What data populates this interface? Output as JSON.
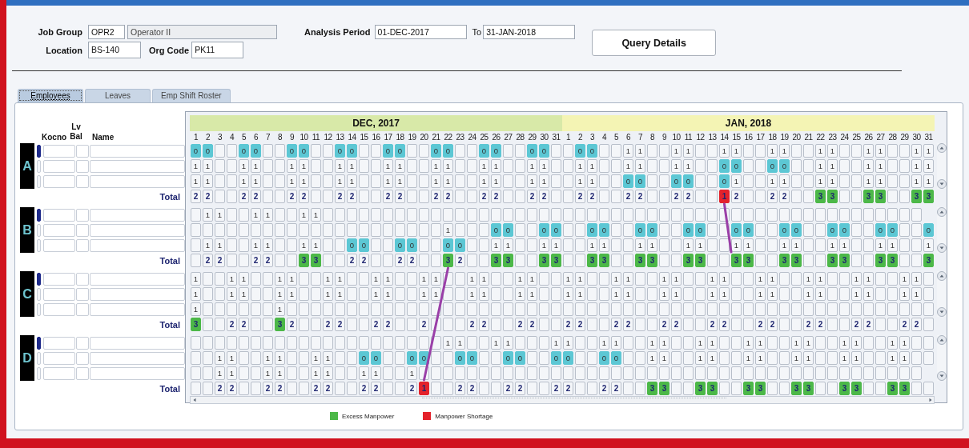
{
  "form": {
    "job_group_label": "Job Group",
    "job_group_code": "OPR2",
    "job_group_name": "Operator II",
    "analysis_period_label": "Analysis Period",
    "period_from": "01-DEC-2017",
    "to_label": "To",
    "period_to": "31-JAN-2018",
    "location_label": "Location",
    "location": "BS-140",
    "org_code_label": "Org Code",
    "org_code": "PK11",
    "query_button": "Query Details"
  },
  "tabs": [
    {
      "label": "Employees",
      "selected": true
    },
    {
      "label": "Leaves",
      "selected": false
    },
    {
      "label": "Emp Shift Roster",
      "selected": false
    }
  ],
  "columns": {
    "kocno": "Kocno",
    "lv_bal": "Lv Bal",
    "name": "Name"
  },
  "months": [
    {
      "label": "DEC, 2017",
      "color": "#d8e9a8",
      "days": [
        "1",
        "2",
        "3",
        "4",
        "5",
        "6",
        "7",
        "8",
        "9",
        "10",
        "11",
        "12",
        "13",
        "14",
        "15",
        "16",
        "17",
        "18",
        "19",
        "20",
        "21",
        "22",
        "23",
        "24",
        "25",
        "26",
        "27",
        "28",
        "29",
        "30",
        "31"
      ]
    },
    {
      "label": "JAN, 2018",
      "color": "#f4f4b4",
      "days": [
        "1",
        "2",
        "3",
        "4",
        "5",
        "6",
        "7",
        "8",
        "9",
        "10",
        "11",
        "12",
        "13",
        "14",
        "15",
        "16",
        "17",
        "18",
        "19",
        "20",
        "21",
        "22",
        "23",
        "24",
        "25",
        "26",
        "27",
        "28",
        "29",
        "30",
        "31"
      ]
    }
  ],
  "groups": [
    {
      "label": "A",
      "rows": [
        {
          "selected": true,
          "cells": [
            {
              "text": "0",
              "kind": "leave"
            },
            {
              "text": "0",
              "kind": "leave"
            },
            "",
            "",
            {
              "text": "0",
              "kind": "leave"
            },
            {
              "text": "0",
              "kind": "leave"
            },
            "",
            "",
            {
              "text": "0",
              "kind": "leave"
            },
            {
              "text": "0",
              "kind": "leave"
            },
            "",
            "",
            {
              "text": "0",
              "kind": "leave"
            },
            {
              "text": "0",
              "kind": "leave"
            },
            "",
            "",
            {
              "text": "0",
              "kind": "leave"
            },
            {
              "text": "0",
              "kind": "leave"
            },
            "",
            "",
            {
              "text": "0",
              "kind": "leave"
            },
            {
              "text": "0",
              "kind": "leave"
            },
            "",
            "",
            {
              "text": "0",
              "kind": "leave"
            },
            {
              "text": "0",
              "kind": "leave"
            },
            "",
            "",
            {
              "text": "0",
              "kind": "leave"
            },
            {
              "text": "0",
              "kind": "leave"
            },
            "",
            "",
            {
              "text": "0",
              "kind": "leave"
            },
            {
              "text": "0",
              "kind": "leave"
            },
            "",
            "",
            "1",
            "1",
            "",
            "",
            "1",
            "1",
            "",
            "",
            "1",
            "1",
            "",
            "",
            "1",
            "1",
            "",
            "",
            "1",
            "1",
            "",
            "",
            "1",
            "1",
            "",
            "",
            "1",
            "1"
          ]
        },
        {
          "selected": false,
          "cells": [
            "1",
            "1",
            "",
            "",
            "1",
            "1",
            "",
            "",
            "1",
            "1",
            "",
            "",
            "1",
            "1",
            "",
            "",
            "1",
            "1",
            "",
            "",
            "1",
            "1",
            "",
            "",
            "1",
            "1",
            "",
            "",
            "1",
            "1",
            "",
            "",
            "1",
            "1",
            "",
            "",
            "1",
            "1",
            "",
            "",
            "1",
            "1",
            "",
            "",
            {
              "text": "0",
              "kind": "leave"
            },
            {
              "text": "0",
              "kind": "leave"
            },
            "",
            "",
            {
              "text": "0",
              "kind": "leave"
            },
            {
              "text": "0",
              "kind": "leave"
            },
            "",
            "",
            "1",
            "1",
            "",
            "",
            "1",
            "1",
            "",
            "",
            "1",
            "1"
          ]
        },
        {
          "selected": false,
          "cells": [
            "1",
            "1",
            "",
            "",
            "1",
            "1",
            "",
            "",
            "1",
            "1",
            "",
            "",
            "1",
            "1",
            "",
            "",
            "1",
            "1",
            "",
            "",
            "1",
            "1",
            "",
            "",
            "1",
            "1",
            "",
            "",
            "1",
            "1",
            "",
            "",
            "1",
            "1",
            "",
            "",
            {
              "text": "0",
              "kind": "leave"
            },
            {
              "text": "0",
              "kind": "leave"
            },
            "",
            "",
            {
              "text": "0",
              "kind": "leave"
            },
            {
              "text": "0",
              "kind": "leave"
            },
            "",
            "",
            {
              "text": "0",
              "kind": "leave"
            },
            "1",
            "",
            "",
            "1",
            "1",
            "",
            "",
            "1",
            "1",
            "",
            "",
            "1",
            "1",
            "",
            "",
            "1",
            "1"
          ]
        }
      ],
      "total": {
        "label": "Total",
        "cells": [
          "2",
          "2",
          "",
          "",
          "2",
          "2",
          "",
          "",
          "2",
          "2",
          "",
          "",
          "2",
          "2",
          "",
          "",
          "2",
          "2",
          "",
          "",
          "2",
          "2",
          "",
          "",
          "2",
          "2",
          "",
          "",
          "2",
          "2",
          "",
          "",
          "2",
          "2",
          "",
          "",
          "2",
          "2",
          "",
          "",
          "2",
          "2",
          "",
          "",
          {
            "text": "1",
            "kind": "shortage"
          },
          "2",
          "",
          "",
          "2",
          "2",
          "",
          "",
          {
            "text": "3",
            "kind": "excess"
          },
          {
            "text": "3",
            "kind": "excess"
          },
          "",
          "",
          {
            "text": "3",
            "kind": "excess"
          },
          {
            "text": "3",
            "kind": "excess"
          },
          "",
          "",
          {
            "text": "3",
            "kind": "excess"
          },
          {
            "text": "3",
            "kind": "excess"
          }
        ]
      }
    },
    {
      "label": "B",
      "rows": [
        {
          "selected": true,
          "cells": [
            "",
            "1",
            "1",
            "",
            "",
            "1",
            "1",
            "",
            "",
            "1",
            "1",
            "",
            "",
            "",
            "",
            "",
            "",
            "",
            "",
            "",
            "",
            "",
            "",
            "",
            "",
            "",
            "",
            "",
            "",
            "",
            "",
            "",
            "",
            "",
            "",
            "",
            "",
            "",
            "",
            "",
            "",
            "",
            "",
            "",
            "",
            "",
            "",
            "",
            "",
            "",
            "",
            "",
            "",
            "",
            "",
            "",
            "",
            "",
            "",
            "",
            ""
          ]
        },
        {
          "selected": false,
          "cells": [
            "",
            "",
            "",
            "",
            "",
            "",
            "",
            "",
            "",
            "",
            "",
            "",
            "",
            "",
            "",
            "",
            "",
            "",
            "",
            "",
            "",
            "1",
            "",
            "",
            "",
            {
              "text": "0",
              "kind": "leave"
            },
            {
              "text": "0",
              "kind": "leave"
            },
            "",
            "",
            {
              "text": "0",
              "kind": "leave"
            },
            {
              "text": "0",
              "kind": "leave"
            },
            "",
            "",
            {
              "text": "0",
              "kind": "leave"
            },
            {
              "text": "0",
              "kind": "leave"
            },
            "",
            "",
            {
              "text": "0",
              "kind": "leave"
            },
            {
              "text": "0",
              "kind": "leave"
            },
            "",
            "",
            {
              "text": "0",
              "kind": "leave"
            },
            {
              "text": "0",
              "kind": "leave"
            },
            "",
            "",
            {
              "text": "0",
              "kind": "leave"
            },
            {
              "text": "0",
              "kind": "leave"
            },
            "",
            "",
            {
              "text": "0",
              "kind": "leave"
            },
            {
              "text": "0",
              "kind": "leave"
            },
            "",
            "",
            {
              "text": "0",
              "kind": "leave"
            },
            {
              "text": "0",
              "kind": "leave"
            },
            "",
            "",
            {
              "text": "0",
              "kind": "leave"
            },
            {
              "text": "0",
              "kind": "leave"
            },
            "",
            "",
            {
              "text": "0",
              "kind": "leave"
            }
          ]
        },
        {
          "selected": false,
          "cells": [
            "",
            "1",
            "1",
            "",
            "",
            "1",
            "1",
            "",
            "",
            "1",
            "1",
            "",
            "",
            {
              "text": "0",
              "kind": "leave"
            },
            {
              "text": "0",
              "kind": "leave"
            },
            "",
            "",
            {
              "text": "0",
              "kind": "leave"
            },
            {
              "text": "0",
              "kind": "leave"
            },
            "",
            "",
            {
              "text": "0",
              "kind": "leave"
            },
            {
              "text": "0",
              "kind": "leave"
            },
            "",
            "",
            "1",
            "1",
            "",
            "",
            "1",
            "1",
            "",
            "",
            "1",
            "1",
            "",
            "",
            "1",
            "1",
            "",
            "",
            "1",
            "1",
            "",
            "",
            "1",
            "1",
            "",
            "",
            "1",
            "1",
            "",
            "",
            "1",
            "1",
            "",
            "",
            "1",
            "1",
            "",
            "",
            "1"
          ]
        }
      ],
      "total": {
        "label": "Total",
        "cells": [
          "",
          "2",
          "2",
          "",
          "",
          "2",
          "2",
          "",
          "",
          {
            "text": "3",
            "kind": "excess"
          },
          {
            "text": "3",
            "kind": "excess"
          },
          "",
          "",
          "2",
          "2",
          "",
          "",
          "2",
          "2",
          "",
          "",
          {
            "text": "3",
            "kind": "excess"
          },
          "2",
          "",
          "",
          {
            "text": "3",
            "kind": "excess"
          },
          {
            "text": "3",
            "kind": "excess"
          },
          "",
          "",
          {
            "text": "3",
            "kind": "excess"
          },
          {
            "text": "3",
            "kind": "excess"
          },
          "",
          "",
          {
            "text": "3",
            "kind": "excess"
          },
          {
            "text": "3",
            "kind": "excess"
          },
          "",
          "",
          {
            "text": "3",
            "kind": "excess"
          },
          {
            "text": "3",
            "kind": "excess"
          },
          "",
          "",
          {
            "text": "3",
            "kind": "excess"
          },
          {
            "text": "3",
            "kind": "excess"
          },
          "",
          "",
          {
            "text": "3",
            "kind": "excess"
          },
          {
            "text": "3",
            "kind": "excess"
          },
          "",
          "",
          {
            "text": "3",
            "kind": "excess"
          },
          {
            "text": "3",
            "kind": "excess"
          },
          "",
          "",
          {
            "text": "3",
            "kind": "excess"
          },
          {
            "text": "3",
            "kind": "excess"
          },
          "",
          "",
          {
            "text": "3",
            "kind": "excess"
          },
          {
            "text": "3",
            "kind": "excess"
          },
          "",
          "",
          {
            "text": "3",
            "kind": "excess"
          }
        ]
      }
    },
    {
      "label": "C",
      "rows": [
        {
          "selected": true,
          "cells": [
            "1",
            "",
            "",
            "1",
            "1",
            "",
            "",
            "1",
            "1",
            "",
            "",
            "1",
            "1",
            "",
            "",
            "1",
            "1",
            "",
            "",
            "1",
            "1",
            "",
            "",
            "1",
            "1",
            "",
            "",
            "1",
            "1",
            "",
            "",
            "1",
            "1",
            "",
            "",
            "1",
            "1",
            "",
            "",
            "1",
            "1",
            "",
            "",
            "1",
            "1",
            "",
            "",
            "1",
            "1",
            "",
            "",
            "1",
            "1",
            "",
            "",
            "1",
            "1",
            "",
            "",
            "1",
            "1",
            ""
          ]
        },
        {
          "selected": false,
          "cells": [
            "1",
            "",
            "",
            "1",
            "1",
            "",
            "",
            "1",
            "1",
            "",
            "",
            "1",
            "1",
            "",
            "",
            "1",
            "1",
            "",
            "",
            "1",
            "1",
            "",
            "",
            "1",
            "1",
            "",
            "",
            "1",
            "1",
            "",
            "",
            "1",
            "1",
            "",
            "",
            "1",
            "1",
            "",
            "",
            "1",
            "1",
            "",
            "",
            "1",
            "1",
            "",
            "",
            "1",
            "1",
            "",
            "",
            "1",
            "1",
            "",
            "",
            "1",
            "1",
            "",
            "",
            "1",
            "1",
            ""
          ]
        },
        {
          "selected": false,
          "cells": [
            "1",
            "",
            "",
            "",
            "",
            "",
            "",
            "1",
            "",
            "",
            "",
            "",
            "",
            "",
            "",
            "",
            "",
            "",
            "",
            "",
            "",
            "",
            "",
            "",
            "",
            "",
            "",
            "",
            "",
            "",
            "",
            "",
            "",
            "",
            "",
            "",
            "",
            "",
            "",
            "",
            "",
            "",
            "",
            "",
            "",
            "",
            "",
            "",
            "",
            "",
            "",
            "",
            "",
            "",
            "",
            "",
            "",
            "",
            "",
            "",
            "",
            ""
          ]
        }
      ],
      "total": {
        "label": "Total",
        "cells": [
          {
            "text": "3",
            "kind": "excess"
          },
          "",
          "",
          "2",
          "2",
          "",
          "",
          {
            "text": "3",
            "kind": "excess"
          },
          "2",
          "",
          "",
          "2",
          "2",
          "",
          "",
          "2",
          "2",
          "",
          "",
          "2",
          "",
          "",
          "",
          "2",
          "2",
          "",
          "",
          "2",
          "2",
          "",
          "",
          "2",
          "2",
          "",
          "",
          "2",
          "2",
          "",
          "",
          "2",
          "2",
          "",
          "",
          "2",
          "2",
          "",
          "",
          "2",
          "2",
          "",
          "",
          "2",
          "2",
          "",
          "",
          "2",
          "2",
          "",
          "",
          "2",
          "2",
          ""
        ]
      }
    },
    {
      "label": "D",
      "rows": [
        {
          "selected": true,
          "cells": [
            "",
            "",
            "",
            "",
            "",
            "",
            "",
            "",
            "",
            "",
            "",
            "",
            "",
            "",
            "",
            "",
            "",
            "",
            "",
            "",
            "",
            "1",
            "1",
            "",
            "",
            "1",
            "1",
            "",
            "",
            "",
            "1",
            "1",
            "",
            "",
            "1",
            "1",
            "",
            "",
            "1",
            "1",
            "",
            "",
            "1",
            "1",
            "",
            "",
            "1",
            "1",
            "",
            "",
            "1",
            "1",
            "",
            "",
            "1",
            "1",
            "",
            "",
            "1",
            "1",
            "",
            ""
          ]
        },
        {
          "selected": false,
          "cells": [
            "",
            "",
            "1",
            "1",
            "",
            "",
            "1",
            "1",
            "",
            "",
            "1",
            "1",
            "",
            "",
            {
              "text": "0",
              "kind": "leave"
            },
            {
              "text": "0",
              "kind": "leave"
            },
            "",
            "",
            {
              "text": "0",
              "kind": "leave"
            },
            {
              "text": "0",
              "kind": "leave"
            },
            "",
            "",
            {
              "text": "0",
              "kind": "leave"
            },
            {
              "text": "0",
              "kind": "leave"
            },
            "",
            "",
            {
              "text": "0",
              "kind": "leave"
            },
            {
              "text": "0",
              "kind": "leave"
            },
            "",
            "",
            {
              "text": "0",
              "kind": "leave"
            },
            {
              "text": "0",
              "kind": "leave"
            },
            "",
            "",
            {
              "text": "0",
              "kind": "leave"
            },
            {
              "text": "0",
              "kind": "leave"
            },
            "",
            "",
            "1",
            "1",
            "",
            "",
            "1",
            "1",
            "",
            "",
            "1",
            "1",
            "",
            "",
            "1",
            "1",
            "",
            "",
            "1",
            "1",
            "",
            "",
            "1",
            "1",
            "",
            ""
          ]
        },
        {
          "selected": false,
          "cells": [
            "",
            "",
            "1",
            "1",
            "",
            "",
            "1",
            "1",
            "",
            "",
            "1",
            "1",
            "",
            "",
            "1",
            "1",
            "",
            "",
            "1",
            "",
            "",
            "",
            "",
            "",
            "",
            "",
            "",
            "",
            "",
            "",
            "",
            "",
            "",
            "",
            "",
            "",
            "",
            "",
            "",
            "",
            "",
            "",
            "",
            "",
            "",
            "",
            "",
            "",
            "",
            "",
            "",
            "",
            "",
            "",
            "",
            "",
            "",
            "",
            "",
            "",
            ""
          ]
        }
      ],
      "total": {
        "label": "Total",
        "cells": [
          "",
          "",
          "2",
          "2",
          "",
          "",
          "2",
          "2",
          "",
          "",
          "2",
          "2",
          "",
          "",
          "2",
          "2",
          "",
          "",
          "2",
          {
            "text": "1",
            "kind": "shortage"
          },
          "",
          "",
          "2",
          "2",
          "",
          "",
          "2",
          "2",
          "",
          "",
          "2",
          "2",
          "",
          "",
          "2",
          "2",
          "",
          "",
          {
            "text": "3",
            "kind": "excess"
          },
          {
            "text": "3",
            "kind": "excess"
          },
          "",
          "",
          {
            "text": "3",
            "kind": "excess"
          },
          {
            "text": "3",
            "kind": "excess"
          },
          "",
          "",
          {
            "text": "3",
            "kind": "excess"
          },
          {
            "text": "3",
            "kind": "excess"
          },
          "",
          "",
          {
            "text": "3",
            "kind": "excess"
          },
          {
            "text": "3",
            "kind": "excess"
          },
          "",
          "",
          {
            "text": "3",
            "kind": "excess"
          },
          {
            "text": "3",
            "kind": "excess"
          },
          "",
          "",
          {
            "text": "3",
            "kind": "excess"
          },
          {
            "text": "3",
            "kind": "excess"
          },
          "",
          ""
        ]
      }
    }
  ],
  "annotations": [
    {
      "kind": "line"
    },
    {
      "kind": "line"
    }
  ],
  "legend": [
    {
      "label": "Excess Manpower",
      "color": "#4cb848"
    },
    {
      "label": "Manpower Shortage",
      "color": "#e4222b"
    }
  ]
}
